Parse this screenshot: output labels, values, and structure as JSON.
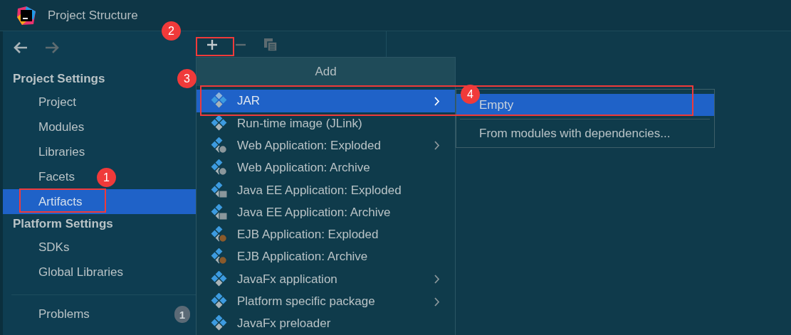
{
  "window": {
    "title": "Project Structure"
  },
  "sidebar": {
    "sections": [
      {
        "title": "Project Settings",
        "items": [
          {
            "label": "Project",
            "selected": false
          },
          {
            "label": "Modules",
            "selected": false
          },
          {
            "label": "Libraries",
            "selected": false
          },
          {
            "label": "Facets",
            "selected": false
          },
          {
            "label": "Artifacts",
            "selected": true
          }
        ]
      },
      {
        "title": "Platform Settings",
        "items": [
          {
            "label": "SDKs",
            "selected": false
          },
          {
            "label": "Global Libraries",
            "selected": false
          }
        ]
      }
    ],
    "problems": {
      "label": "Problems",
      "count": "1"
    }
  },
  "toolbar": {
    "add_enabled": true,
    "remove_enabled": false,
    "copy_enabled": false
  },
  "add_menu": {
    "title": "Add",
    "items": [
      {
        "label": "JAR",
        "kind": "jar",
        "selected": true,
        "has_submenu": true
      },
      {
        "label": "Run-time image (JLink)",
        "kind": "jar",
        "selected": false,
        "has_submenu": false
      },
      {
        "label": "Web Application: Exploded",
        "kind": "web",
        "selected": false,
        "has_submenu": true
      },
      {
        "label": "Web Application: Archive",
        "kind": "web",
        "selected": false,
        "has_submenu": false
      },
      {
        "label": "Java EE Application: Exploded",
        "kind": "javaee",
        "selected": false,
        "has_submenu": false
      },
      {
        "label": "Java EE Application: Archive",
        "kind": "javaee",
        "selected": false,
        "has_submenu": false
      },
      {
        "label": "EJB Application: Exploded",
        "kind": "ejb",
        "selected": false,
        "has_submenu": false
      },
      {
        "label": "EJB Application: Archive",
        "kind": "ejb",
        "selected": false,
        "has_submenu": false
      },
      {
        "label": "JavaFx application",
        "kind": "jar",
        "selected": false,
        "has_submenu": true
      },
      {
        "label": "Platform specific package",
        "kind": "jar",
        "selected": false,
        "has_submenu": true
      },
      {
        "label": "JavaFx preloader",
        "kind": "jar",
        "selected": false,
        "has_submenu": false
      }
    ]
  },
  "jar_submenu": {
    "items": [
      {
        "label": "Empty",
        "selected": true
      },
      {
        "label": "From modules with dependencies...",
        "selected": false
      }
    ]
  },
  "annotations": [
    {
      "number": "1"
    },
    {
      "number": "2"
    },
    {
      "number": "3"
    },
    {
      "number": "4"
    }
  ]
}
